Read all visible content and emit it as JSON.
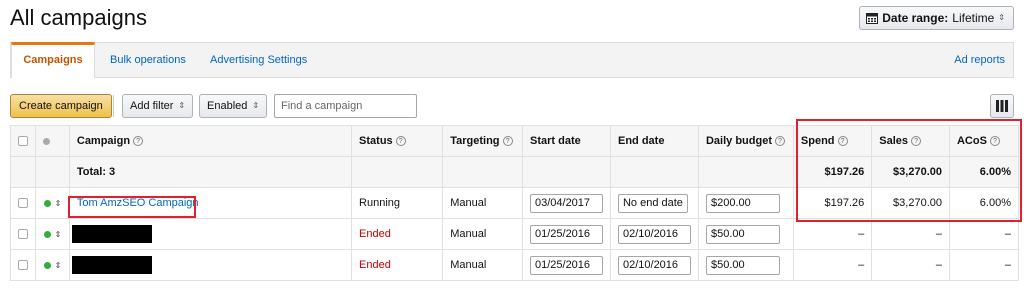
{
  "page": {
    "title": "All campaigns"
  },
  "date_range": {
    "label": "Date range:",
    "value": "Lifetime",
    "icon": "calendar-icon"
  },
  "tabs": [
    {
      "label": "Campaigns",
      "active": true
    },
    {
      "label": "Bulk operations",
      "active": false
    },
    {
      "label": "Advertising Settings",
      "active": false
    }
  ],
  "tab_right": {
    "label": "Ad reports"
  },
  "toolbar": {
    "create_label": "Create campaign",
    "filter_label": "Add filter",
    "enabled_label": "Enabled",
    "search_placeholder": "Find a campaign",
    "columns_icon": "columns-icon"
  },
  "table": {
    "headers": {
      "campaign": "Campaign",
      "status": "Status",
      "targeting": "Targeting",
      "start_date": "Start date",
      "end_date": "End date",
      "daily_budget": "Daily budget",
      "spend": "Spend",
      "sales": "Sales",
      "acos": "ACoS"
    },
    "total": {
      "label": "Total: 3",
      "spend": "$197.26",
      "sales": "$3,270.00",
      "acos": "6.00%"
    },
    "rows": [
      {
        "campaign": "Tom AmzSEO Campaign",
        "status": "Running",
        "targeting": "Manual",
        "start_date": "03/04/2017",
        "end_date": "No end date",
        "daily_budget": "$200.00",
        "spend": "$197.26",
        "sales": "$3,270.00",
        "acos": "6.00%"
      },
      {
        "campaign": "",
        "status": "Ended",
        "targeting": "Manual",
        "start_date": "01/25/2016",
        "end_date": "02/10/2016",
        "daily_budget": "$50.00",
        "spend": "–",
        "sales": "–",
        "acos": "–"
      },
      {
        "campaign": "",
        "status": "Ended",
        "targeting": "Manual",
        "start_date": "01/25/2016",
        "end_date": "02/10/2016",
        "daily_budget": "$50.00",
        "spend": "–",
        "sales": "–",
        "acos": "–"
      }
    ]
  },
  "colors": {
    "accent": "#e47911",
    "link": "#0066c0",
    "ended": "#c40000",
    "running_dot": "#2fae3c",
    "highlight": "#e0202e"
  }
}
